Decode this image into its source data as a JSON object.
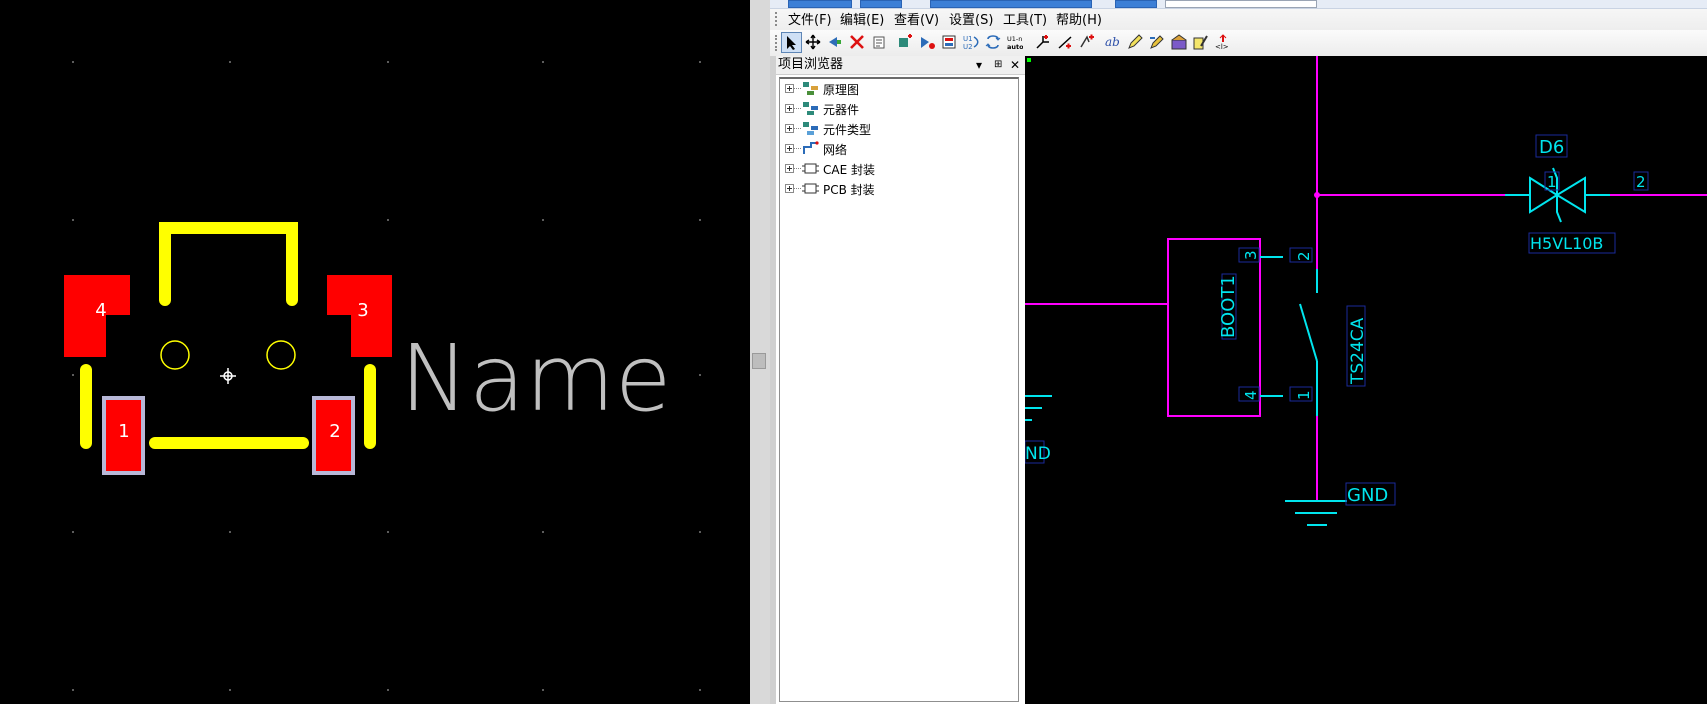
{
  "pcb": {
    "pad_labels": [
      "4",
      "3",
      "1",
      "2"
    ],
    "name_text": "Name"
  },
  "menu": {
    "items": [
      "文件(F)",
      "编辑(E)",
      "查看(V)",
      "设置(S)",
      "工具(T)",
      "帮助(H)"
    ]
  },
  "browser": {
    "title": "项目浏览器",
    "pin_glyph": "▾",
    "dock_glyph": "⊞",
    "close_glyph": "✕",
    "items": [
      {
        "label": "原理图",
        "icon": "schematic-icon"
      },
      {
        "label": "元器件",
        "icon": "parts-icon"
      },
      {
        "label": "元件类型",
        "icon": "part-types-icon"
      },
      {
        "label": "网络",
        "icon": "nets-icon"
      },
      {
        "label": "CAE 封装",
        "icon": "cae-decal-icon"
      },
      {
        "label": "PCB 封装",
        "icon": "pcb-decal-icon"
      }
    ]
  },
  "schematic": {
    "diode_ref": "D6",
    "diode_pin1": "1",
    "diode_pin2": "2",
    "diode_value": "H5VL10B",
    "boot_ref": "BOOT1",
    "boot_pin3": "3",
    "boot_pin4": "4",
    "switch_value": "TS24CA",
    "switch_pin2": "2",
    "switch_pin1": "1",
    "gnd_label": "GND",
    "gnd_partial": "ND"
  },
  "colors": {
    "pad": "#ff0000",
    "silkscreen": "#ffff00",
    "wire": "#ff00ff",
    "symbol": "#00e5ee",
    "name_text": "#c0c0c0"
  }
}
